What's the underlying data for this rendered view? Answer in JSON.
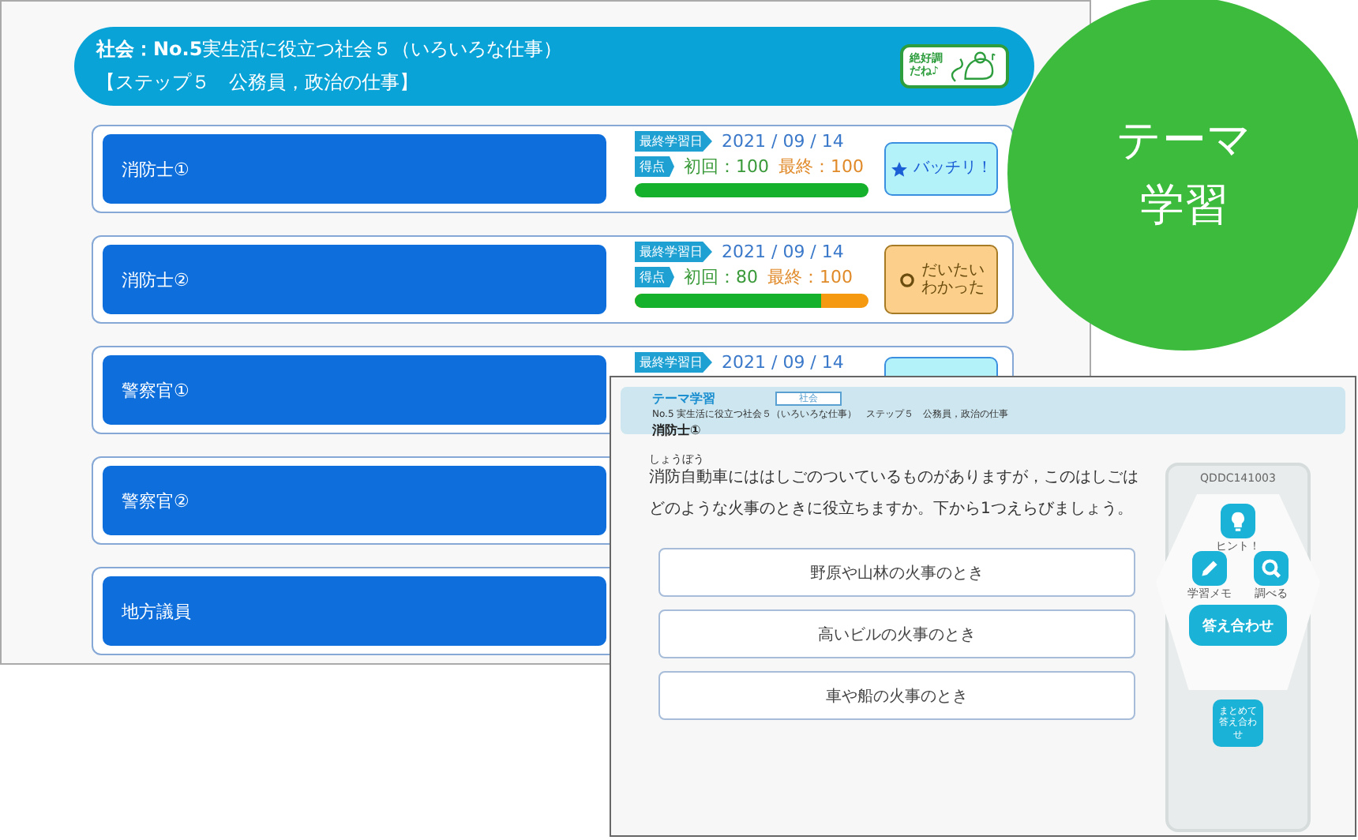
{
  "back_screen": {
    "header": {
      "title": "**社会：No.5**実生活に役立つ社会５（いろいろな仕事）",
      "subtitle": "【ステップ５　公務員，政治の仕事】",
      "stamp": [
        "絶好調",
        "だね♪"
      ]
    },
    "lessons": [
      {
        "title": "消防士①",
        "date_label": "最終学習日",
        "date": "2021 / 09 / 14",
        "score_label": "得点",
        "first": "初回：100",
        "last": "最終：100",
        "level": 1,
        "status": {
          "kind": "star",
          "lines": [
            "バッチリ！"
          ]
        }
      },
      {
        "title": "消防士②",
        "date_label": "最終学習日",
        "date": "2021 / 09 / 14",
        "score_label": "得点",
        "first": "初回：80",
        "last": "最終：100",
        "level": 0.8,
        "status": {
          "kind": "circle",
          "lines": [
            "だいたい",
            "わかった"
          ]
        }
      },
      {
        "title": "警察官①",
        "date_label": "最終学習日",
        "date": "2021 / 09 / 14",
        "status": {
          "kind": "blank"
        }
      },
      {
        "title": "警察官②"
      },
      {
        "title": "地方議員"
      }
    ]
  },
  "front_screen": {
    "header": {
      "app": "テーマ学習",
      "subject": "社会",
      "path": "No.5 実生活に役立つ社会５（いろいろな仕事）　ステップ５　公務員，政治の仕事",
      "lesson": "消防士①"
    },
    "question": {
      "ruby_base": "消防",
      "ruby": "しょうぼう",
      "text": "自動車にははしごのついているものがありますが，このはしごはどのような火事のときに役立ちますか。下から1つえらびましょう。"
    },
    "options": [
      "野原や山林の火事のとき",
      "高いビルの火事のとき",
      "車や船の火事のとき"
    ],
    "panel": {
      "code": "QDDC141003",
      "hint": "ヒント！",
      "memo": "学習メモ",
      "search": "調べる",
      "answer": "答え合わせ",
      "batch": "まとめて答え合わせ"
    }
  },
  "badge": [
    "テーマ",
    "学習"
  ]
}
